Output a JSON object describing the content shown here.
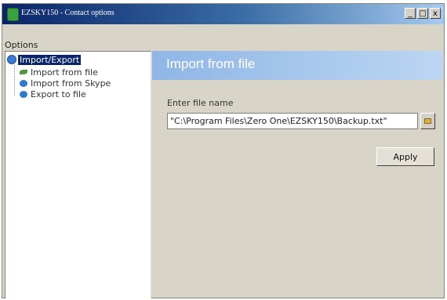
{
  "window": {
    "title": "EZSKY150 - Contact options",
    "buttons": {
      "minimize": "_",
      "maximize": "□",
      "close": "x"
    }
  },
  "sidebar": {
    "label": "Options",
    "root": {
      "label": "Import/Export",
      "icon": "globe-icon"
    },
    "items": [
      {
        "label": "Import from file",
        "icon": "leaf-icon"
      },
      {
        "label": "Import from Skype",
        "icon": "disk-icon"
      },
      {
        "label": "Export to file",
        "icon": "disk-icon"
      }
    ]
  },
  "content": {
    "title": "Import from file",
    "file_label": "Enter file name",
    "file_value": "\"C:\\Program Files\\Zero One\\EZSKY150\\Backup.txt\"",
    "apply_label": "Apply"
  }
}
